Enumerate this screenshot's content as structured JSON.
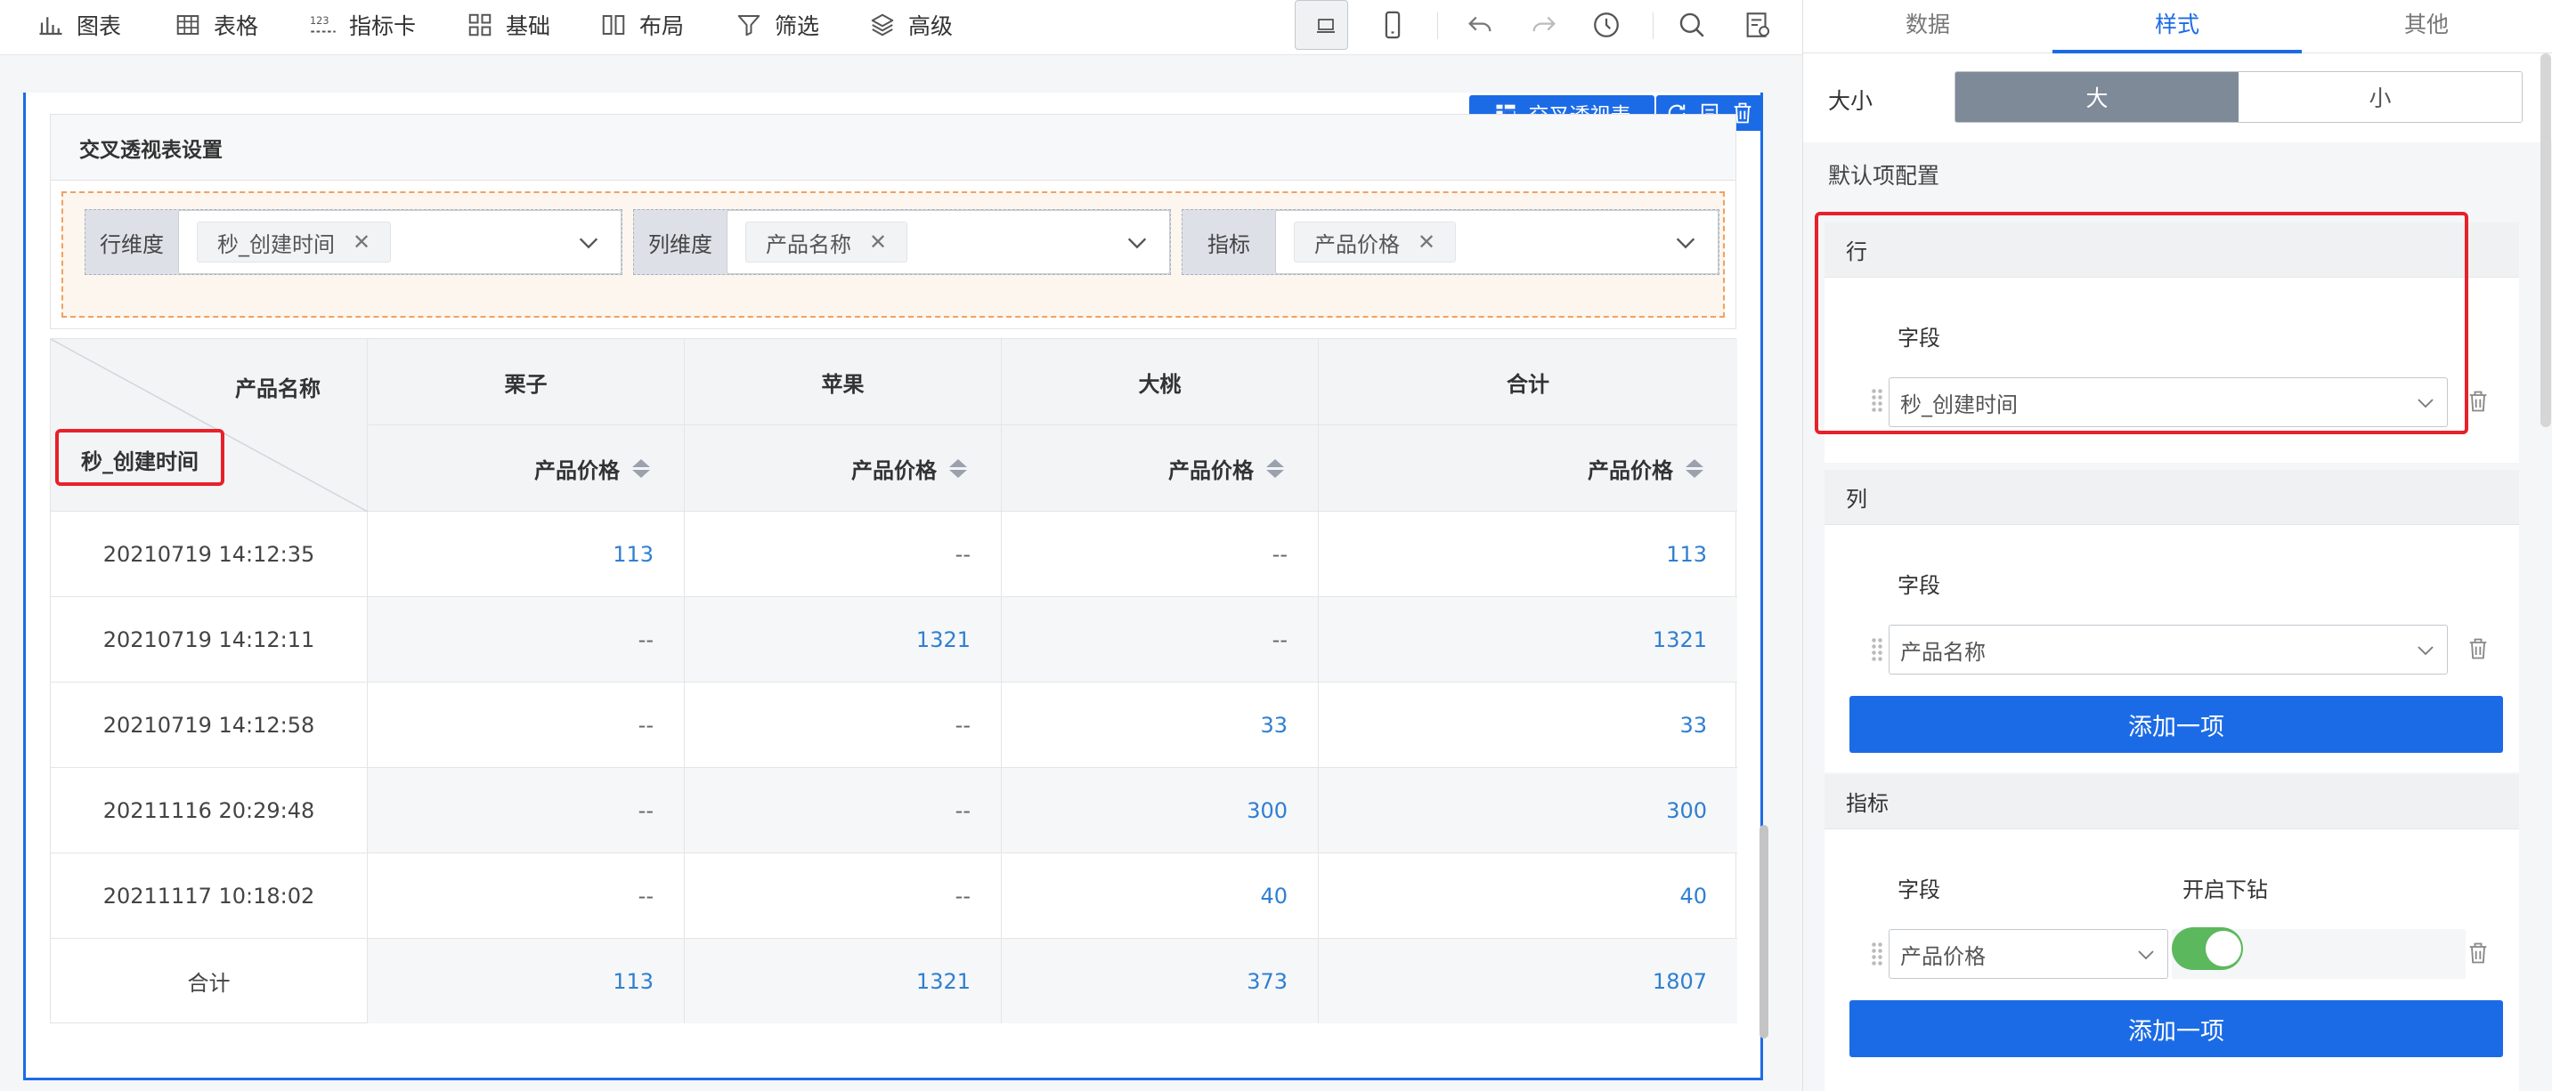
{
  "toolbar": {
    "items": [
      {
        "label": "图表",
        "icon": "bar-chart-icon"
      },
      {
        "label": "表格",
        "icon": "table-icon"
      },
      {
        "label": "指标卡",
        "icon": "kpi-card-icon"
      },
      {
        "label": "基础",
        "icon": "basic-components-icon"
      },
      {
        "label": "布局",
        "icon": "layout-icon"
      },
      {
        "label": "筛选",
        "icon": "filter-icon"
      },
      {
        "label": "高级",
        "icon": "layers-icon"
      }
    ],
    "kpi_icon_text": "123",
    "right_icons": [
      "desktop-icon",
      "mobile-icon",
      "undo-icon",
      "redo-icon",
      "history-icon",
      "search-icon",
      "page-settings-icon"
    ]
  },
  "widget": {
    "tag_label": "交叉透视表",
    "tools": [
      "refresh-icon",
      "copy-icon",
      "delete-icon"
    ]
  },
  "pivot_settings": {
    "title": "交叉透视表设置",
    "row_dim": {
      "label": "行维度",
      "value": "秒_创建时间"
    },
    "col_dim": {
      "label": "列维度",
      "value": "产品名称"
    },
    "metric": {
      "label": "指标",
      "value": "产品价格"
    },
    "remove_glyph": "✕"
  },
  "table": {
    "corner_col_header": "产品名称",
    "corner_row_header": "秒_创建时间",
    "columns": [
      "栗子",
      "苹果",
      "大桃",
      "合计"
    ],
    "metric_header": "产品价格",
    "rows": [
      {
        "label": "20210719 14:12:35",
        "values": [
          "113",
          "--",
          "--",
          "113"
        ]
      },
      {
        "label": "20210719 14:12:11",
        "values": [
          "--",
          "1321",
          "--",
          "1321"
        ]
      },
      {
        "label": "20210719 14:12:58",
        "values": [
          "--",
          "--",
          "33",
          "33"
        ]
      },
      {
        "label": "20211116 20:29:48",
        "values": [
          "--",
          "--",
          "300",
          "300"
        ]
      },
      {
        "label": "20211117 10:18:02",
        "values": [
          "--",
          "--",
          "40",
          "40"
        ]
      }
    ],
    "total": {
      "label": "合计",
      "values": [
        "113",
        "1321",
        "373",
        "1807"
      ]
    }
  },
  "right_panel": {
    "tabs": [
      "数据",
      "样式",
      "其他"
    ],
    "active_tab": "样式",
    "size_label": "大小",
    "size_options": [
      "大",
      "小"
    ],
    "size_selected": "大",
    "default_config_label": "默认项配置",
    "row_section": {
      "title": "行",
      "field_label": "字段",
      "field_value": "秒_创建时间"
    },
    "col_section": {
      "title": "列",
      "field_label": "字段",
      "field_value": "产品名称",
      "add_label": "添加一项"
    },
    "metric_section": {
      "title": "指标",
      "field_label": "字段",
      "drill_label": "开启下钻",
      "field_value": "产品价格",
      "drill_enabled": true,
      "add_label": "添加一项"
    }
  },
  "colors": {
    "accent": "#1c6be6",
    "highlight": "#e8202a",
    "link_value": "#2f7fd1",
    "toggle_on": "#5cb85c"
  }
}
